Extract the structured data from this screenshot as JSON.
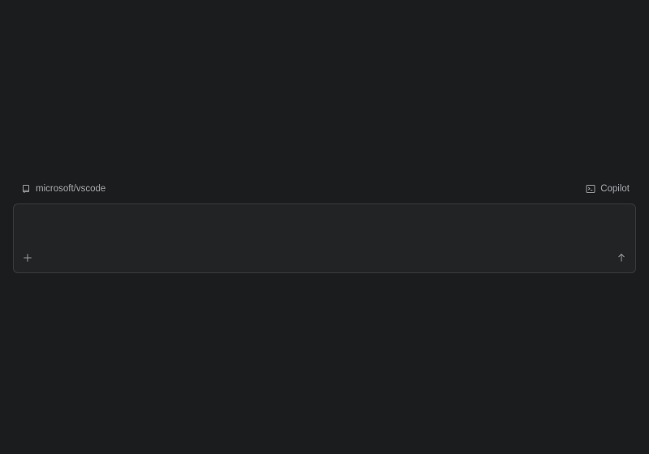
{
  "context": {
    "repository": "microsoft/vscode",
    "repository_icon": "repo-icon",
    "agent_label": "Copilot",
    "agent_icon": "terminal-icon"
  },
  "composer": {
    "value": "",
    "placeholder": "",
    "add_icon": "plus-icon",
    "send_icon": "arrow-up-icon"
  },
  "colors": {
    "background": "#1b1c1e",
    "composer_background": "#222325",
    "composer_border": "#3a3b3e",
    "text_muted": "#a8a9ac",
    "send_disabled": "#56575a"
  }
}
